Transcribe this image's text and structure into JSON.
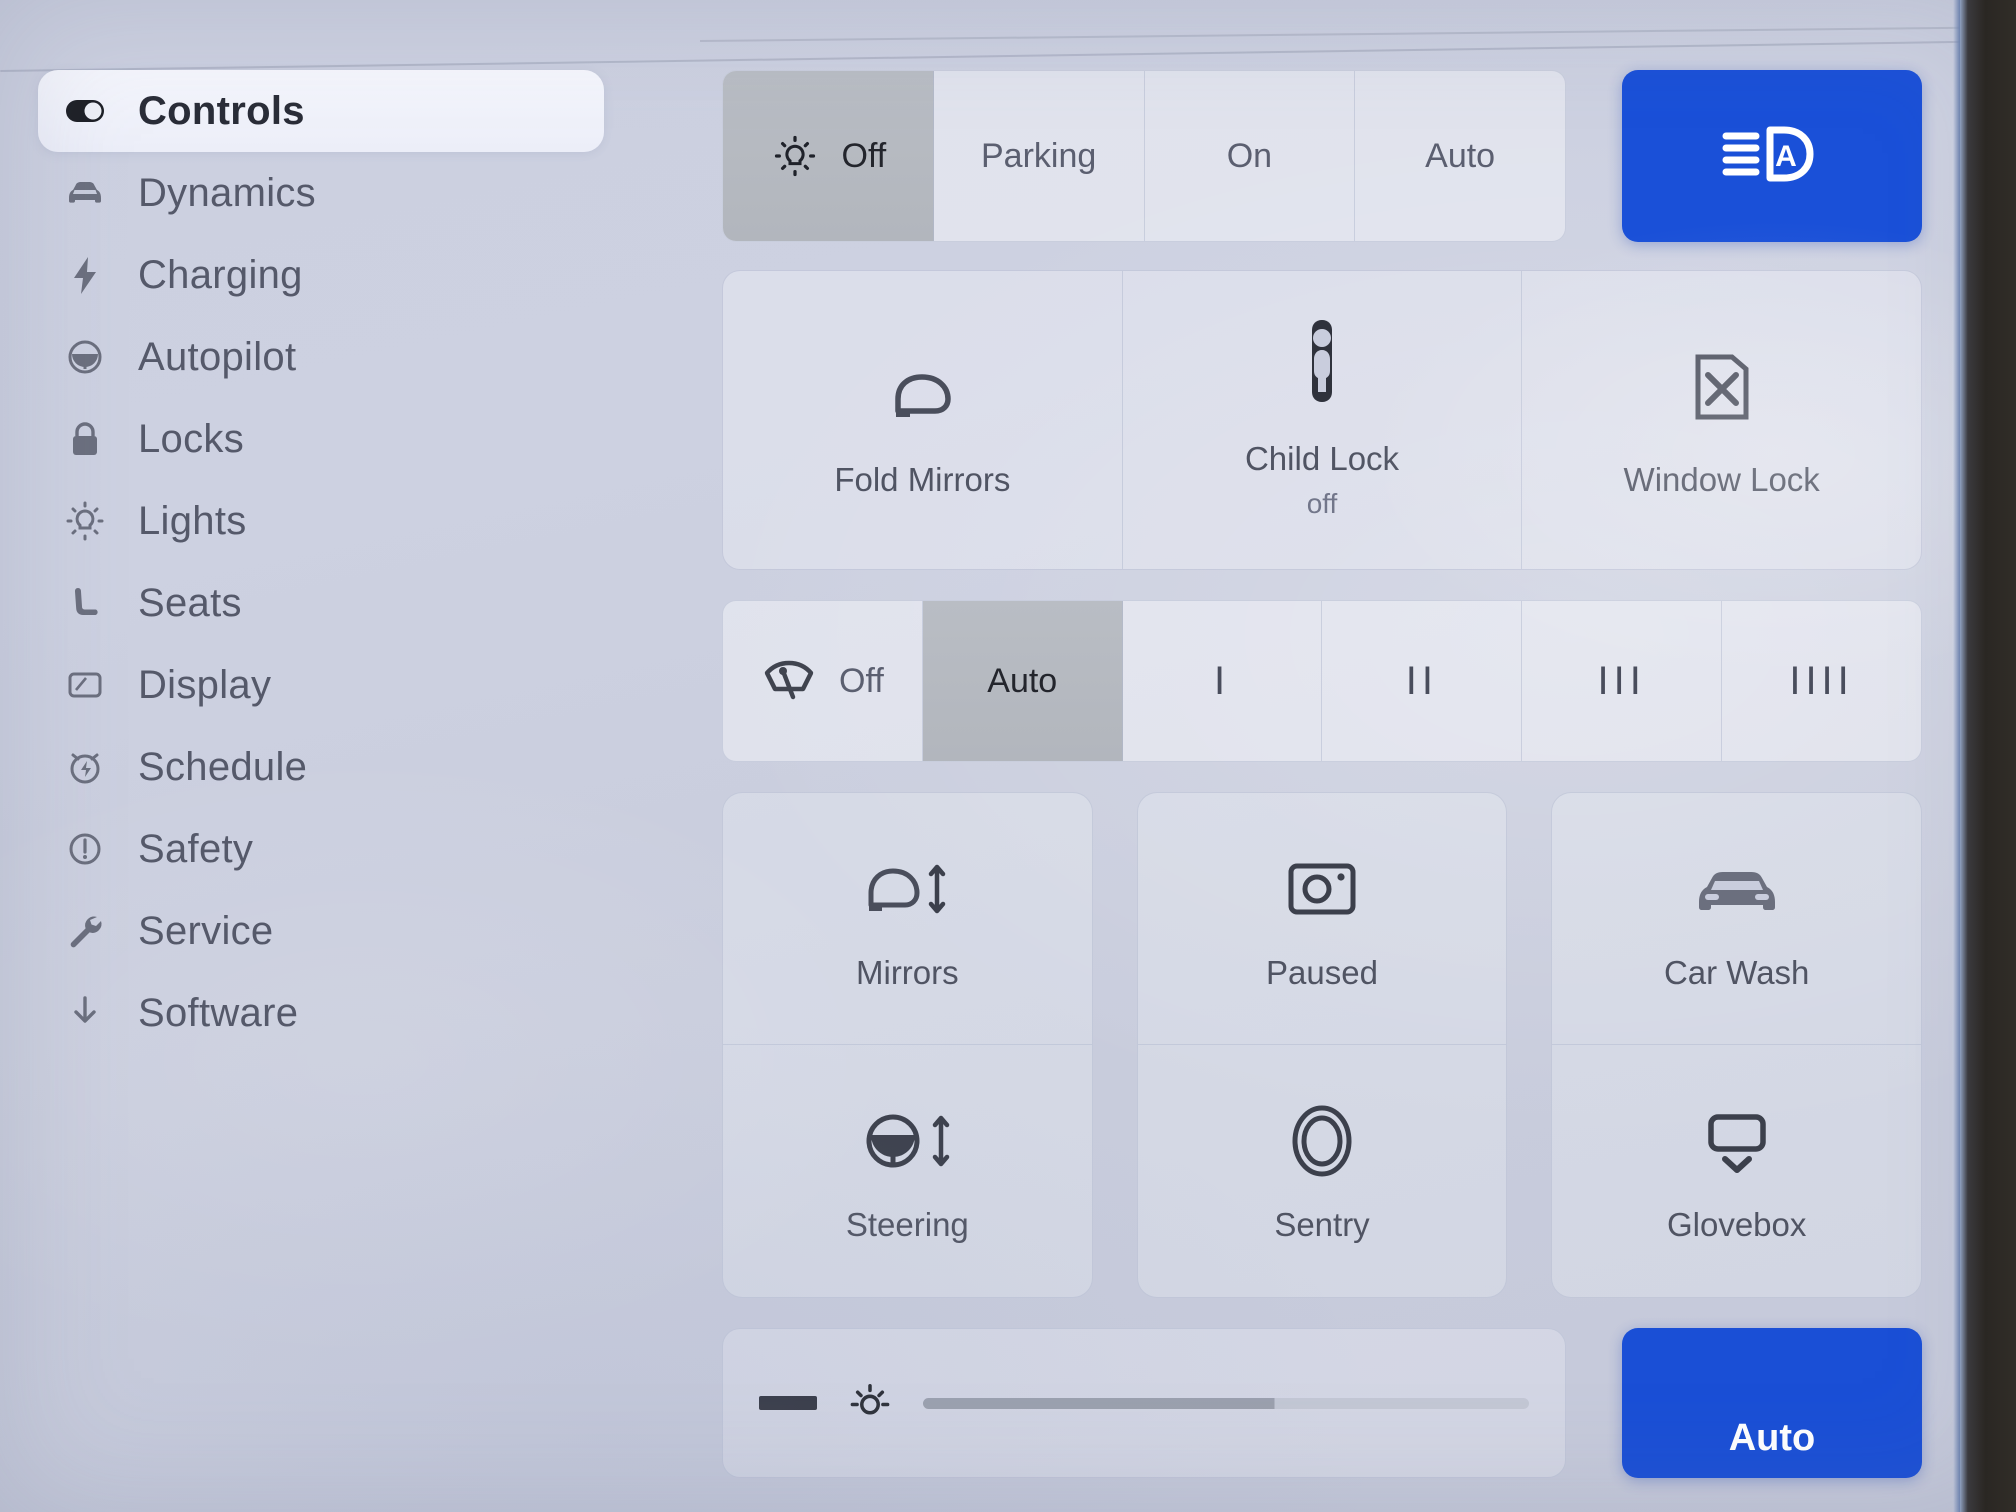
{
  "sidebar": {
    "items": [
      {
        "label": "Controls",
        "icon": "toggle-switch-icon",
        "active": true
      },
      {
        "label": "Dynamics",
        "icon": "car-front-icon",
        "active": false
      },
      {
        "label": "Charging",
        "icon": "lightning-bolt-icon",
        "active": false
      },
      {
        "label": "Autopilot",
        "icon": "steering-wheel-icon",
        "active": false
      },
      {
        "label": "Locks",
        "icon": "padlock-icon",
        "active": false
      },
      {
        "label": "Lights",
        "icon": "lightbulb-icon",
        "active": false
      },
      {
        "label": "Seats",
        "icon": "car-seat-icon",
        "active": false
      },
      {
        "label": "Display",
        "icon": "display-screen-icon",
        "active": false
      },
      {
        "label": "Schedule",
        "icon": "alarm-clock-icon",
        "active": false
      },
      {
        "label": "Safety",
        "icon": "alert-circle-icon",
        "active": false
      },
      {
        "label": "Service",
        "icon": "wrench-icon",
        "active": false
      },
      {
        "label": "Software",
        "icon": "download-icon",
        "active": false
      }
    ]
  },
  "headlights": {
    "icon": "headlight-bulb-icon",
    "options": [
      "Off",
      "Parking",
      "On",
      "Auto"
    ],
    "selected": "Off",
    "high_beam_button": {
      "icon": "auto-high-beam-icon",
      "active": true,
      "color": "#1a50d8"
    }
  },
  "quick_tiles": [
    {
      "label": "Fold Mirrors",
      "sub": "",
      "icon": "side-mirror-icon"
    },
    {
      "label": "Child Lock",
      "sub": "off",
      "icon": "child-lock-icon"
    },
    {
      "label": "Window Lock",
      "sub": "",
      "icon": "window-lock-icon"
    }
  ],
  "wipers": {
    "icon": "windshield-wiper-icon",
    "options": [
      "Off",
      "Auto",
      "I",
      "II",
      "III",
      "IIII"
    ],
    "selected": "Auto"
  },
  "grid": {
    "columns": [
      [
        {
          "label": "Mirrors",
          "icon": "mirror-adjust-icon"
        },
        {
          "label": "Steering",
          "icon": "steering-adjust-icon"
        }
      ],
      [
        {
          "label": "Paused",
          "icon": "dashcam-icon"
        },
        {
          "label": "Sentry",
          "icon": "sentry-mode-icon"
        }
      ],
      [
        {
          "label": "Car Wash",
          "icon": "car-wash-icon"
        },
        {
          "label": "Glovebox",
          "icon": "glovebox-icon"
        }
      ]
    ]
  },
  "brightness": {
    "minus_icon": "minus-icon",
    "sun_icon": "brightness-sun-icon",
    "level_percent": 58,
    "auto_label": "Auto"
  },
  "colors": {
    "accent_blue": "#1a50d8",
    "background": "#c9cddd",
    "selected_segment": "#b6babf",
    "text_primary": "#2a2d38",
    "text_secondary": "#55596a"
  }
}
